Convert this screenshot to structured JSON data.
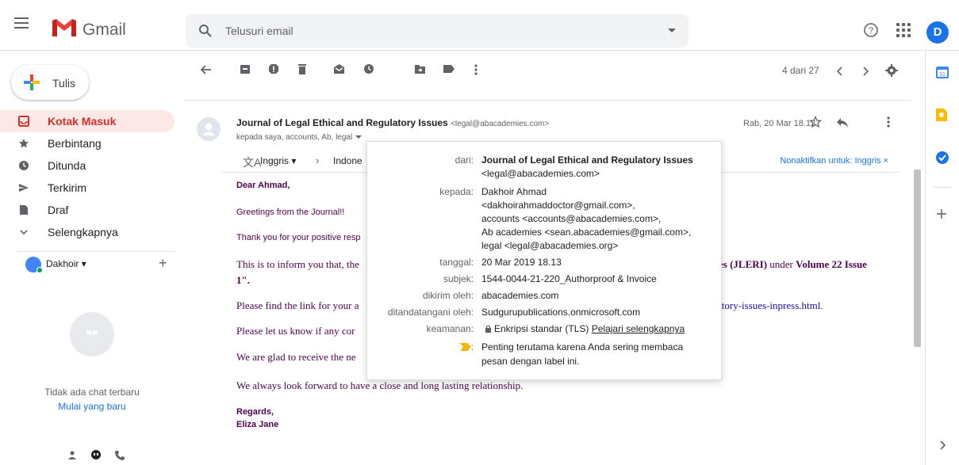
{
  "header": {
    "brand": "Gmail",
    "search_placeholder": "Telusuri email",
    "avatar_letter": "D"
  },
  "sidebar": {
    "compose_label": "Tulis",
    "items": [
      {
        "label": "Kotak Masuk",
        "icon": "inbox-icon",
        "active": true
      },
      {
        "label": "Berbintang",
        "icon": "star-icon"
      },
      {
        "label": "Ditunda",
        "icon": "clock-icon"
      },
      {
        "label": "Terkirim",
        "icon": "send-icon"
      },
      {
        "label": "Draf",
        "icon": "draft-icon"
      },
      {
        "label": "Selengkapnya",
        "icon": "chevron-down-icon"
      }
    ],
    "hangouts_user": "Dakhoir",
    "chat_empty": "Tidak ada chat terbaru",
    "chat_start": "Mulai yang baru"
  },
  "toolbar": {
    "pager": "4 dari 27"
  },
  "email": {
    "sender_name": "Journal of Legal Ethical and Regulatory Issues",
    "sender_email": "<legal@abacademies.com>",
    "recipients": "kepada saya, accounts, Ab, legal",
    "date": "Rab, 20 Mar 18.13",
    "translate_from": "Inggris",
    "translate_to": "Indone",
    "translate_off": "Nonaktifkan untuk: Inggris",
    "body": {
      "greeting": "Dear Ahmad,",
      "line1": "Greetings from the Journal!!",
      "line2": "Thank you for your positive resp",
      "line3_start": "This is to inform you that, the",
      "line3_end_a": "es (JLERI)",
      "line3_end_b": " under ",
      "line3_end_c": "Volume 22 Issue",
      "line3_cont": "1\".",
      "line4_start": "Please find the link for your a",
      "line4_link": "atory-issues-inpress.html",
      "line4_tail": ".",
      "line5": "Please let us know if any cor",
      "line6": "We are glad to receive the ne",
      "line7": "We always look forward to have a close and long lasting relationship.",
      "regards": "Regards,",
      "signature": "Eliza Jane"
    }
  },
  "details": {
    "from_label": "dari:",
    "from_name": "Journal of Legal Ethical and Regulatory Issues",
    "from_email": "<legal@abacademies.com>",
    "to_label": "kepada:",
    "to_line1": "Dakhoir Ahmad",
    "to_line2": "<dakhoirahmaddoctor@gmail.com>,",
    "to_line3": "accounts <accounts@abacademies.com>,",
    "to_line4": "Ab academies <sean.abacademies@gmail.com>,",
    "to_line5": "legal <legal@abacademies.org>",
    "date_label": "tanggal:",
    "date_value": "20 Mar 2019 18.13",
    "subject_label": "subjek:",
    "subject_value": "1544-0044-21-220_Authorproof & Invoice",
    "mailedby_label": "dikirim oleh:",
    "mailedby_value": "abacademies.com",
    "signedby_label": "ditandatangani oleh:",
    "signedby_value": "Sudgurupublications.onmicrosoft.com",
    "security_label": "keamanan:",
    "security_value": "Enkripsi standar (TLS)",
    "security_link": "Pelajari selengkapnya",
    "importance_line1": "Penting terutama karena Anda sering membaca",
    "importance_line2": "pesan dengan label ini."
  }
}
